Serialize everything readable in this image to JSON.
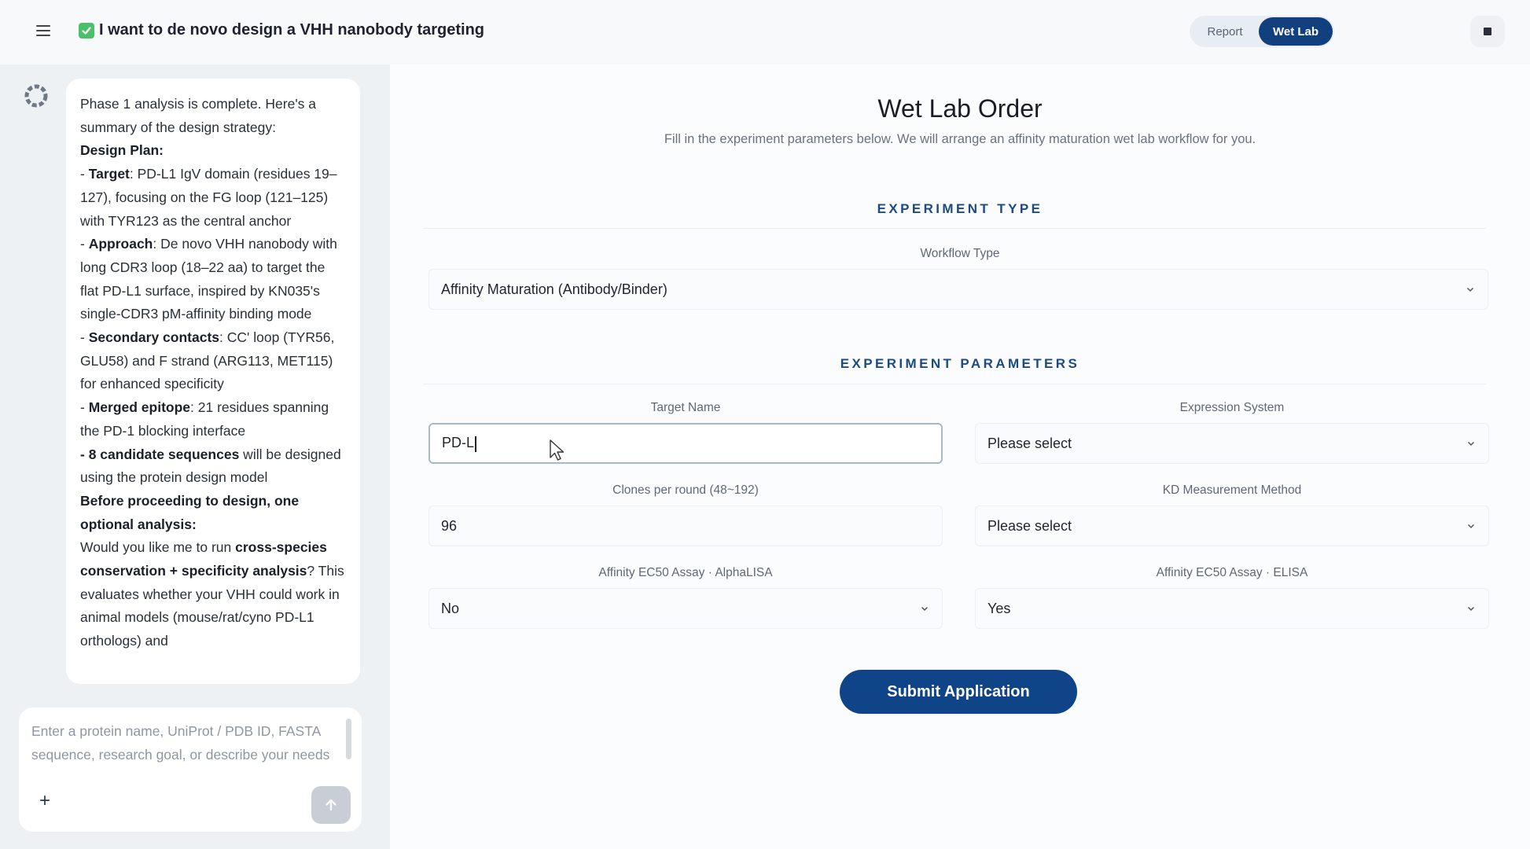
{
  "header": {
    "title": "I want to de novo design a VHH nanobody targeting",
    "toggle": {
      "report_label": "Report",
      "wetlab_label": "Wet Lab"
    }
  },
  "chat": {
    "message": {
      "intro": "Phase 1 analysis is complete. Here's a summary of the design strategy:",
      "plan_heading": "Design Plan:",
      "items": [
        {
          "prefix": "- ",
          "label": "Target",
          "text": ": PD-L1 IgV domain (residues 19–127), focusing on the FG loop (121–125) with TYR123 as the central anchor"
        },
        {
          "prefix": "- ",
          "label": "Approach",
          "text": ": De novo VHH nanobody with long CDR3 loop (18–22 aa) to target the flat PD-L1 surface, inspired by KN035's single-CDR3 pM-affinity binding mode"
        },
        {
          "prefix": "- ",
          "label": "Secondary contacts",
          "text": ": CC' loop (TYR56, GLU58) and F strand (ARG113, MET115) for enhanced specificity"
        },
        {
          "prefix": "- ",
          "label": "Merged epitope",
          "text": ": 21 residues spanning the PD-1 blocking interface"
        },
        {
          "prefix": "",
          "label": "- 8 candidate sequences",
          "text": " will be designed using the protein design model"
        }
      ],
      "question_heading": "Before proceeding to design, one optional analysis:",
      "question_pre": "Would you like me to run ",
      "question_bold": "cross-species conservation + specificity analysis",
      "question_post": "? This evaluates whether your VHH could work in animal models (mouse/rat/cyno PD-L1 orthologs) and"
    },
    "composer": {
      "placeholder": "Enter a protein name, UniProt / PDB ID, FASTA sequence, research goal, or describe your needs",
      "plus": "+"
    }
  },
  "form": {
    "title": "Wet Lab Order",
    "subtitle": "Fill in the experiment parameters below. We will arrange an affinity maturation wet lab workflow for you.",
    "sections": {
      "type": "EXPERIMENT TYPE",
      "params": "EXPERIMENT PARAMETERS"
    },
    "workflow": {
      "label": "Workflow Type",
      "value": "Affinity Maturation (Antibody/Binder)"
    },
    "target": {
      "label": "Target Name",
      "value": "PD-L"
    },
    "expression": {
      "label": "Expression System",
      "value": "Please select"
    },
    "clones": {
      "label": "Clones per round (48~192)",
      "value": "96"
    },
    "kd": {
      "label": "KD Measurement Method",
      "value": "Please select"
    },
    "alphalisa": {
      "label": "Affinity EC50 Assay · AlphaLISA",
      "value": "No"
    },
    "elisa": {
      "label": "Affinity EC50 Assay · ELISA",
      "value": "Yes"
    },
    "submit_label": "Submit Application"
  },
  "colors": {
    "accent": "#0f4489",
    "toggle_active": "#123f7e",
    "section_title": "#1c4a82",
    "check": "#4cbf6b"
  },
  "icons": {
    "menu": "hamburger-menu-icon",
    "check": "checkmark-icon",
    "stop": "stop-icon",
    "avatar": "bot-avatar-icon",
    "chevron": "chevron-down-icon",
    "send": "arrow-up-icon",
    "plus": "plus-icon",
    "cursor": "mouse-cursor-icon"
  }
}
